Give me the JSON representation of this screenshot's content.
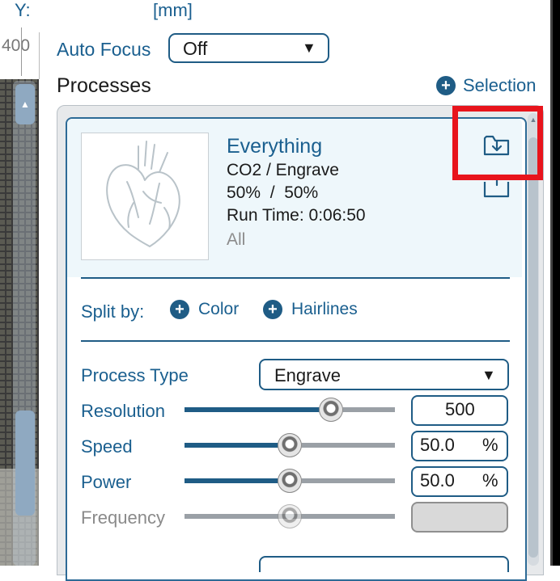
{
  "header": {
    "y_label": "Y:",
    "unit": "[mm]"
  },
  "ruler": {
    "value": "400"
  },
  "auto_focus": {
    "label": "Auto Focus",
    "value": "Off"
  },
  "processes": {
    "title": "Processes",
    "selection_label": "Selection"
  },
  "process_card": {
    "name": "Everything",
    "laser": "CO2 / Engrave",
    "power_speed": "50%  /  50%",
    "run_time": "Run Time: 0:06:50",
    "scope": "All",
    "thumbnail_icon": "heart-outline-icon"
  },
  "split": {
    "label": "Split by:",
    "color_label": "Color",
    "hairlines_label": "Hairlines"
  },
  "settings": {
    "process_type_label": "Process Type",
    "process_type_value": "Engrave",
    "resolution_label": "Resolution",
    "resolution_value": "500",
    "resolution_level": 0.72,
    "speed_label": "Speed",
    "speed_value": "50.0",
    "speed_level": 0.5,
    "power_label": "Power",
    "power_value": "50.0",
    "power_level": 0.5,
    "frequency_label": "Frequency",
    "frequency_level": 0.5,
    "percent_unit": "%"
  },
  "colors": {
    "accent": "#1f5c85",
    "highlight": "#e8141c",
    "card_bg": "#eef7fb"
  }
}
